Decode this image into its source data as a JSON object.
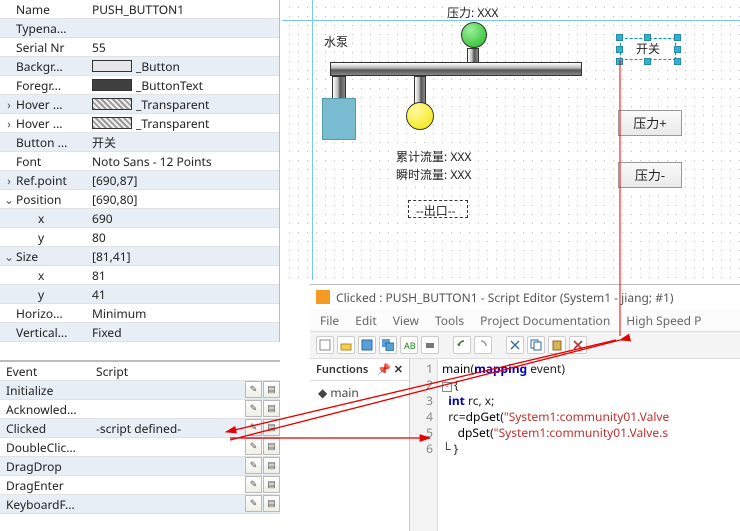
{
  "props": {
    "rows": [
      {
        "exp": "",
        "lbl": "Name",
        "val": "PUSH_BUTTON1",
        "alt": false
      },
      {
        "exp": "",
        "lbl": "Typena...",
        "val": "",
        "alt": true
      },
      {
        "exp": "",
        "lbl": "Serial Nr",
        "val": "55",
        "alt": false
      },
      {
        "exp": "",
        "lbl": "Backgr...",
        "val": "_Button",
        "swatch": "sw-btn",
        "alt": true
      },
      {
        "exp": "",
        "lbl": "Foregr...",
        "val": "_ButtonText",
        "swatch": "sw-btntext",
        "alt": false
      },
      {
        "exp": "›",
        "lbl": "Hover ...",
        "val": "_Transparent",
        "swatch": "sw-trans",
        "alt": true
      },
      {
        "exp": "›",
        "lbl": "Hover ...",
        "val": "_Transparent",
        "swatch": "sw-trans",
        "alt": false
      },
      {
        "exp": "",
        "lbl": "Button ...",
        "val": "开关",
        "alt": true
      },
      {
        "exp": "",
        "lbl": "Font",
        "val": "Noto Sans - 12 Points",
        "alt": false
      },
      {
        "exp": "›",
        "lbl": "Ref.point",
        "val": "[690,87]",
        "alt": true
      },
      {
        "exp": "⌄",
        "lbl": "Position",
        "val": "[690,80]",
        "alt": false
      },
      {
        "exp": "",
        "lbl": "x",
        "val": "690",
        "indent": true,
        "alt": true
      },
      {
        "exp": "",
        "lbl": "y",
        "val": "80",
        "indent": true,
        "alt": false
      },
      {
        "exp": "⌄",
        "lbl": "Size",
        "val": "[81,41]",
        "alt": true
      },
      {
        "exp": "",
        "lbl": "x",
        "val": "81",
        "indent": true,
        "alt": false
      },
      {
        "exp": "",
        "lbl": "y",
        "val": "41",
        "indent": true,
        "alt": true
      },
      {
        "exp": "",
        "lbl": "Horizo...",
        "val": "Minimum",
        "alt": false
      },
      {
        "exp": "",
        "lbl": "Vertical...",
        "val": "Fixed",
        "alt": true
      }
    ]
  },
  "events": {
    "header": {
      "c1": "Event",
      "c2": "Script"
    },
    "rows": [
      {
        "name": "Initialize",
        "val": "",
        "alt": true
      },
      {
        "name": "Acknowled...",
        "val": "",
        "alt": false
      },
      {
        "name": "Clicked",
        "val": "-script defined-",
        "alt": true
      },
      {
        "name": "DoubleClic...",
        "val": "",
        "alt": false
      },
      {
        "name": "DragDrop",
        "val": "",
        "alt": true
      },
      {
        "name": "DragEnter",
        "val": "",
        "alt": false
      },
      {
        "name": "KeyboardF...",
        "val": "",
        "alt": true
      }
    ]
  },
  "canvas": {
    "pump_label": "水泵",
    "pressure_label": "压力: XXX",
    "cumflow": "累计流量: XXX",
    "instflow": "瞬时流量: XXX",
    "outlet": "--出口--",
    "switch": "开关",
    "btn_up": "压力+",
    "btn_down": "压力-"
  },
  "editor": {
    "title": "Clicked : PUSH_BUTTON1 - Script Editor (System1 - jiang; #1)",
    "menu": [
      "File",
      "Edit",
      "View",
      "Tools",
      "Project Documentation",
      "High Speed P"
    ],
    "funcs_hdr": "Functions",
    "funcs_item": "main",
    "code": {
      "l1a": "main",
      "l1b": "(",
      "l1c": "mapping",
      "l1d": " event)",
      "l2": "{",
      "l3a": "  ",
      "l3b": "int",
      "l3c": " rc, x;",
      "l4a": "  rc=",
      "l4b": "dpGet",
      "l4c": "(",
      "l4d": "\"System1:community01.Valve",
      "l5a": "     ",
      "l5b": "dpSet",
      "l5c": "(",
      "l5d": "\"System1:community01.Valve.s",
      "l6": "}"
    }
  }
}
